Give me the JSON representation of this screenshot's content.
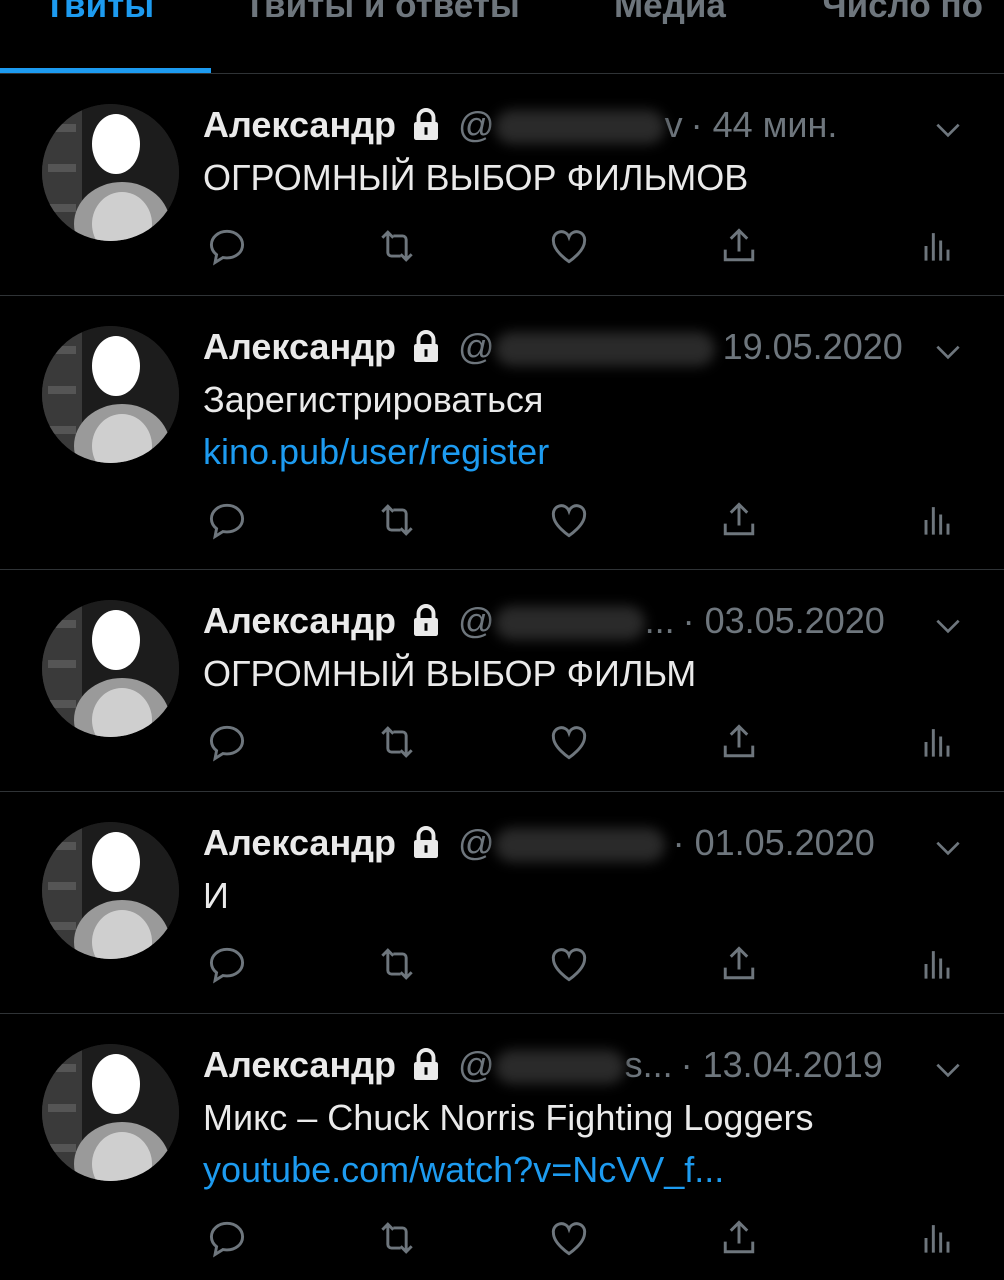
{
  "tabs": [
    "Твиты",
    "Твиты и ответы",
    "Медиа",
    "Число по"
  ],
  "active_tab": 0,
  "colors": {
    "accent": "#1d9bf0",
    "background": "#000000",
    "muted": "#6e767d"
  },
  "tweets": [
    {
      "name": "Александр",
      "handle_start": "@",
      "handle_end": "v",
      "time": "· 44 мин.",
      "text": "ОГРОМНЫЙ ВЫБОР ФИЛЬМОВ",
      "link": ""
    },
    {
      "name": "Александр",
      "handle_start": "@",
      "handle_end": "",
      "time": "19.05.2020",
      "text": "Зарегистрироваться ",
      "link": "kino.pub/user/register"
    },
    {
      "name": "Александр",
      "handle_start": "@",
      "handle_end": "...",
      "time": "· 03.05.2020",
      "text": "ОГРОМНЫЙ ВЫБОР ФИЛЬМ",
      "link": ""
    },
    {
      "name": "Александр",
      "handle_start": "@",
      "handle_end": "",
      "time": "· 01.05.2020",
      "text": "И",
      "link": ""
    },
    {
      "name": "Александр",
      "handle_start": "@",
      "handle_end": "s...",
      "time": "· 13.04.2019",
      "text": "Микс – Chuck Norris Fighting Loggers",
      "link": "youtube.com/watch?v=NcVV_f..."
    }
  ],
  "action_icons": [
    "reply-icon",
    "retweet-icon",
    "like-icon",
    "share-icon",
    "analytics-icon"
  ],
  "header_icons": [
    "lock-icon",
    "chevron-down-icon"
  ]
}
